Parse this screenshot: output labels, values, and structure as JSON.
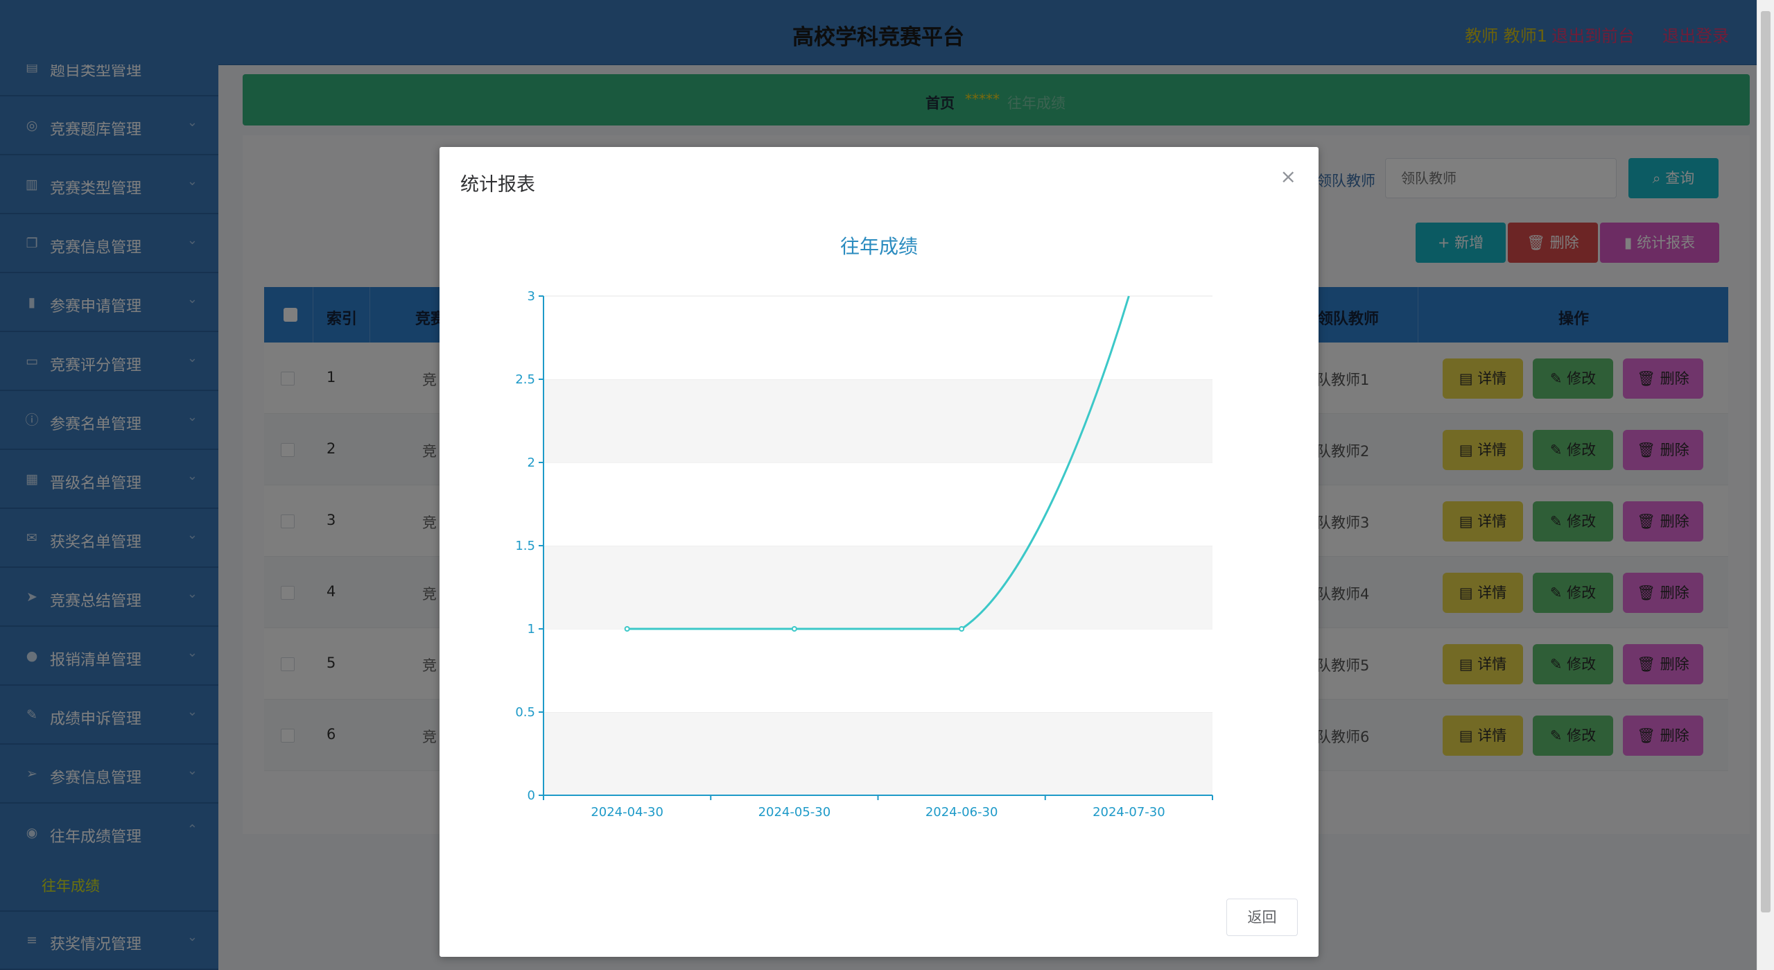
{
  "header": {
    "title": "高校学科竞赛平台",
    "user_label": "教师 教师1",
    "front_link": "退出到前台",
    "logout_link": "退出登录"
  },
  "sidebar": {
    "items": [
      {
        "label": "题目类型管理",
        "icon": "list-icon"
      },
      {
        "label": "竞赛题库管理",
        "icon": "compass-icon"
      },
      {
        "label": "竞赛类型管理",
        "icon": "bar-chart-icon"
      },
      {
        "label": "竞赛信息管理",
        "icon": "copy-icon"
      },
      {
        "label": "参赛申请管理",
        "icon": "histogram-icon"
      },
      {
        "label": "竞赛评分管理",
        "icon": "message-icon"
      },
      {
        "label": "参赛名单管理",
        "icon": "info-icon"
      },
      {
        "label": "晋级名单管理",
        "icon": "grid-icon"
      },
      {
        "label": "获奖名单管理",
        "icon": "mail-icon"
      },
      {
        "label": "竞赛总结管理",
        "icon": "send-icon"
      },
      {
        "label": "报销清单管理",
        "icon": "user-icon"
      },
      {
        "label": "成绩申诉管理",
        "icon": "edit-icon"
      },
      {
        "label": "参赛信息管理",
        "icon": "paper-plane-icon"
      },
      {
        "label": "往年成绩管理",
        "icon": "location-icon"
      },
      {
        "label": "获奖情况管理",
        "icon": "menu-icon"
      }
    ],
    "active_sub": "往年成绩"
  },
  "breadcrumb": {
    "home": "首页",
    "separator": "*****",
    "current": "往年成绩"
  },
  "search": {
    "label": "领队教师",
    "placeholder": "领队教师",
    "query_button": "查询"
  },
  "toolbar": {
    "add": "新增",
    "delete": "删除",
    "stats": "统计报表"
  },
  "table": {
    "headers": [
      "索引",
      "竞赛",
      "领队教师",
      "操作"
    ],
    "rows": [
      {
        "index": "1",
        "name": "竞",
        "teacher": "队教师1"
      },
      {
        "index": "2",
        "name": "竞",
        "teacher": "队教师2"
      },
      {
        "index": "3",
        "name": "竞",
        "teacher": "队教师3"
      },
      {
        "index": "4",
        "name": "竞",
        "teacher": "队教师4"
      },
      {
        "index": "5",
        "name": "竞",
        "teacher": "队教师5"
      },
      {
        "index": "6",
        "name": "竞",
        "teacher": "队教师6"
      }
    ],
    "row_actions": {
      "detail": "详情",
      "edit": "修改",
      "delete": "删除"
    }
  },
  "modal": {
    "title": "统计报表",
    "back_button": "返回"
  },
  "colors": {
    "primary": "#3a78b8",
    "line": "#3cc8c8",
    "axis": "#1e9ac8",
    "chart_title": "#2a8bbf"
  },
  "chart_data": {
    "type": "line",
    "title": "往年成绩",
    "xlabel": "",
    "ylabel": "",
    "categories": [
      "2024-04-30",
      "2024-05-30",
      "2024-06-30",
      "2024-07-30"
    ],
    "values": [
      1,
      1,
      1,
      3
    ],
    "ylim": [
      0,
      3
    ],
    "yticks": [
      "0",
      "0.5",
      "1",
      "1.5",
      "2",
      "2.5",
      "3"
    ],
    "smooth": true,
    "grid": "alternating bands"
  }
}
